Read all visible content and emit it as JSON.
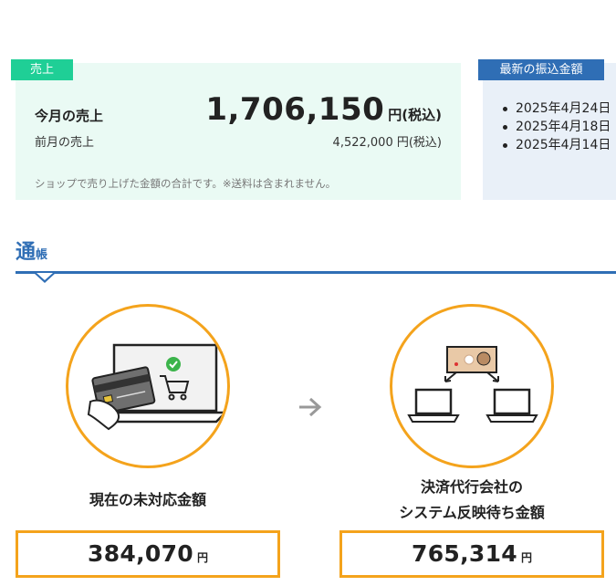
{
  "sales": {
    "tag": "売上",
    "this_month_label": "今月の売上",
    "this_month_value": "1,706,150",
    "this_month_unit": "円(税込)",
    "last_month_label": "前月の売上",
    "last_month_value": "4,522,000 円(税込)",
    "note": "ショップで売り上げた金額の合計です。※送料は含まれません。"
  },
  "transfer": {
    "tag": "最新の振込金額",
    "dates": [
      "2025年4月24日",
      "2025年4月18日",
      "2025年4月14日"
    ]
  },
  "passbook": {
    "title_big": "通",
    "title_small": "帳"
  },
  "unprocessed": {
    "label": "現在の未対応金額",
    "value": "384,070",
    "unit": "円"
  },
  "pending": {
    "label_line1": "決済代行会社の",
    "label_line2": "システム反映待ち金額",
    "value": "765,314",
    "unit": "円"
  },
  "colors": {
    "sales_accent": "#1fcf96",
    "transfer_accent": "#2f6eb5",
    "highlight_orange": "#f4a31c"
  },
  "icons": [
    "card-payment-illustration",
    "check-icon",
    "cart-icon",
    "arrow-right-icon",
    "banknote-transfer-illustration",
    "laptop-icon"
  ]
}
